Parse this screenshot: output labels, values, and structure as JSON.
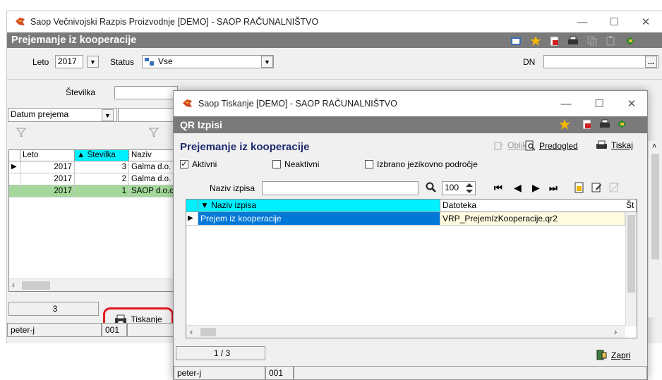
{
  "main": {
    "title": "Saop   Večnivojski Razpis Proizvodnje [DEMO] - SAOP RAČUNALNIŠTVO",
    "module": "Prejemanje iz kooperacije",
    "leto_label": "Leto",
    "leto_value": "2017",
    "status_label": "Status",
    "status_value": "Vse",
    "dn_label": "DN",
    "dn_btn": "...",
    "stevilka_label": "Številka",
    "datum_value": "Datum prejema",
    "grid": {
      "headers": [
        "Leto",
        "▲ Številka",
        "Naziv"
      ],
      "rows": [
        {
          "leto": "2017",
          "stevilka": "3",
          "naziv": "Galma d.o."
        },
        {
          "leto": "2017",
          "stevilka": "2",
          "naziv": "Galma d.o."
        },
        {
          "leto": "2017",
          "stevilka": "1",
          "naziv": "SAOP d.o.o"
        }
      ]
    },
    "count": "3",
    "print_label": "Tiskanje",
    "user": "peter-j",
    "code": "001"
  },
  "dialog": {
    "title": "Saop Tiskanje [DEMO] - SAOP RAČUNALNIŠTVO",
    "module": "QR Izpisi",
    "heading": "Prejemanje iz kooperacije",
    "actions": {
      "oblikuj": "Oblikuj",
      "predogled": "Predogled",
      "tiskaj": "Tiskaj"
    },
    "checkboxes": {
      "aktivni": "Aktivni",
      "neaktivni": "Neaktivni",
      "izbrano": "Izbrano jezikovno področje"
    },
    "search_label": "Naziv izpisa",
    "search_value": "",
    "limit": "100",
    "grid": {
      "headers": [
        "▼ Naziv izpisa",
        "Datoteka",
        "Št"
      ],
      "rows": [
        {
          "naziv": "Prejem iz kooperacije",
          "datoteka": "VRP_PrejemIzKooperacije.qr2"
        }
      ]
    },
    "pager": "1 / 3",
    "close_label": "Zapri",
    "user": "peter-j",
    "code": "001"
  },
  "colors": {
    "accent_cyan": "#00f0ff",
    "selected_blue": "#0078d7",
    "row_green": "#a3d89a",
    "highlight_red": "#e0191f",
    "header_gray": "#7a7a7a"
  }
}
